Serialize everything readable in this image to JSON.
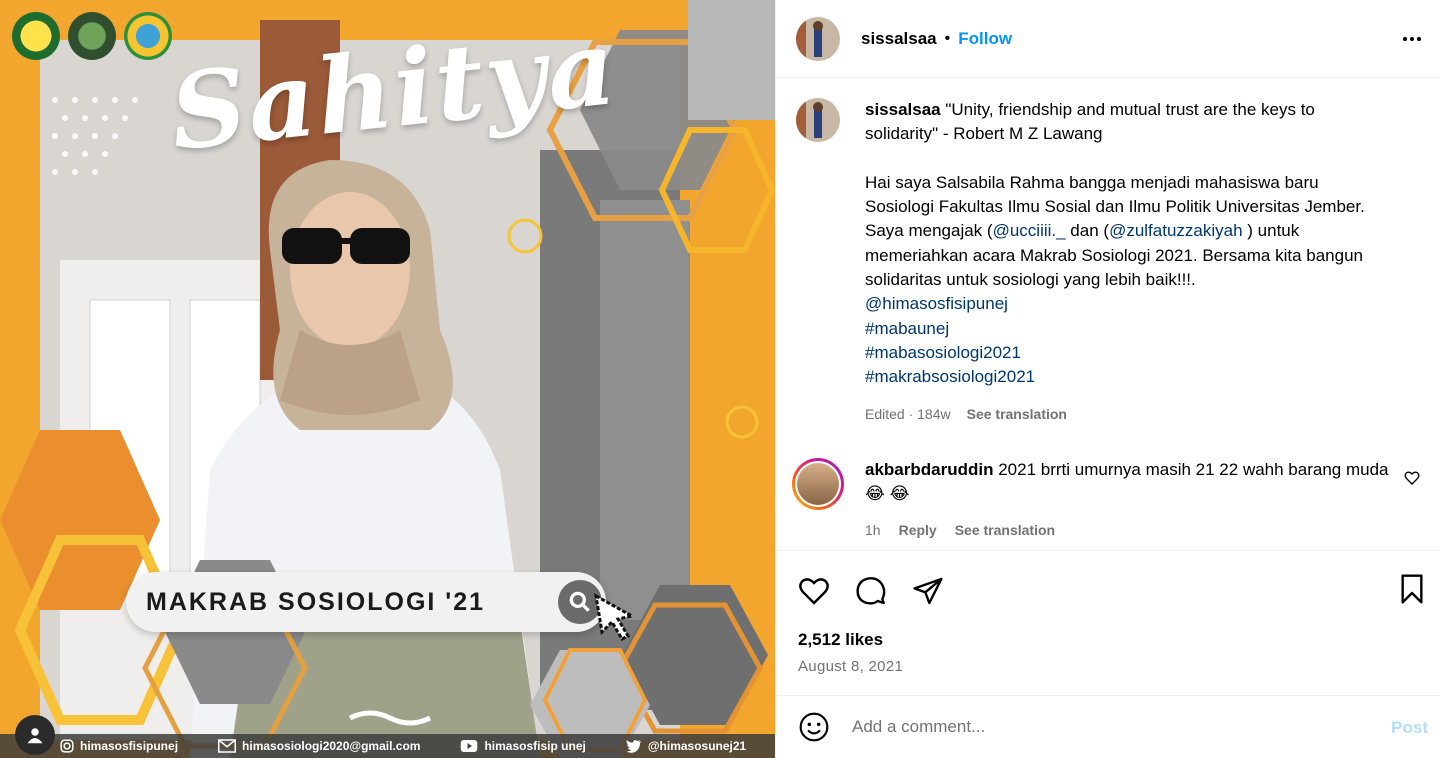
{
  "media": {
    "title": "Sahitya",
    "banner": "MAKRAB SOSIOLOGI '21",
    "footer": [
      "himasosfisipunej",
      "himasosiologi2020@gmail.com",
      "himasosfisip unej",
      "@himasosunej21"
    ]
  },
  "header": {
    "username": "sissalsaa",
    "separator": "•",
    "follow_label": "Follow"
  },
  "caption": {
    "username": "sissalsaa",
    "quote": "\"Unity, friendship and mutual trust are the keys to solidarity\" - Robert M Z Lawang",
    "para_start": "Hai saya Salsabila Rahma bangga menjadi mahasiswa baru Sosiologi Fakultas Ilmu Sosial dan Ilmu Politik Universitas Jember. Saya mengajak (",
    "mention1": "@ucciiii._",
    "para_mid": " dan (",
    "mention2": "@zulfatuzzakiyah",
    "para_end": " ) untuk memeriahkan acara Makrab Sosiologi 2021. Bersama kita bangun solidaritas untuk sosiologi yang lebih baik!!!.",
    "mention3": "@himasosfisipunej",
    "tags": [
      "#mabaunej",
      "#mabasosiologi2021",
      "#makrabsosiologi2021"
    ],
    "edited": "Edited · 184w",
    "see_translation": "See translation"
  },
  "comment": {
    "username": "akbarbdaruddin",
    "text": "2021 brrti umurnya masih 21 22 wahh barang muda😂 😂",
    "time": "1h",
    "reply": "Reply",
    "see_translation": "See translation"
  },
  "stats": {
    "likes": "2,512 likes",
    "date": "August 8, 2021"
  },
  "add_comment": {
    "placeholder": "Add a comment...",
    "post_label": "Post"
  },
  "colors": {
    "accent": "#0095f6",
    "link": "#00376b",
    "muted": "#737373"
  }
}
